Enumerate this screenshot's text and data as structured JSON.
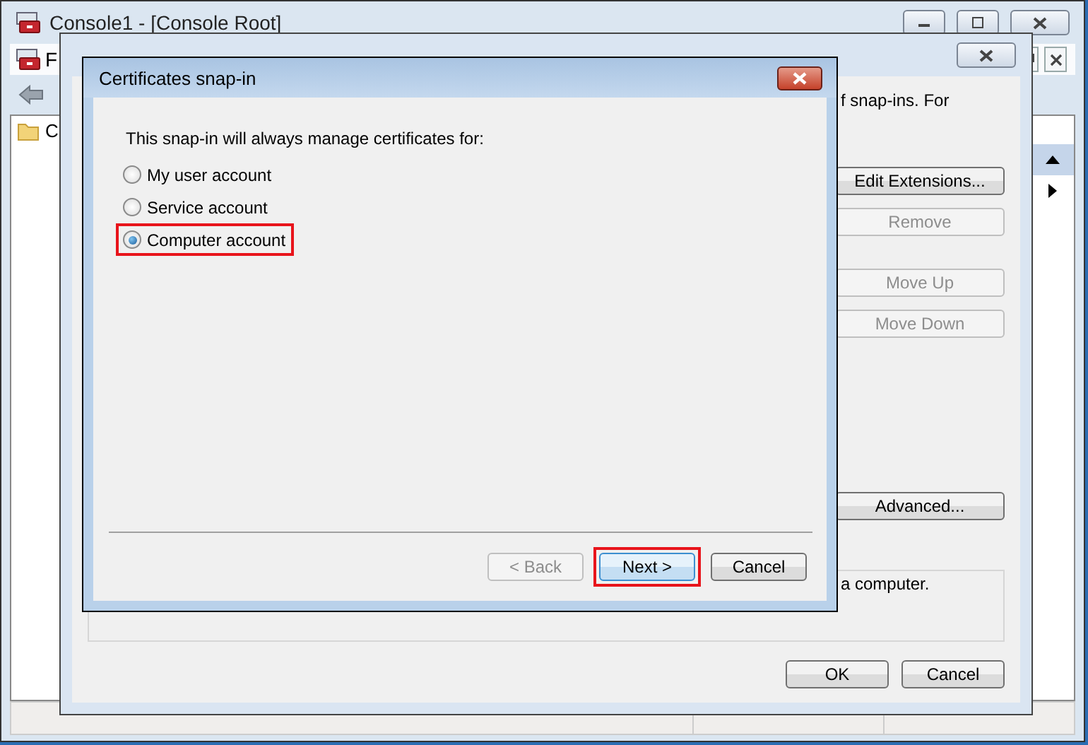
{
  "console_window": {
    "title": "Console1 - [Console Root]",
    "menu_partial": "F",
    "tree_partial": "C"
  },
  "add_remove_dialog": {
    "intro_partial": "f snap-ins. For",
    "side_buttons": [
      {
        "label": "Edit Extensions...",
        "disabled": false
      },
      {
        "label": "Remove",
        "disabled": true
      },
      {
        "label": "Move Up",
        "disabled": true
      },
      {
        "label": "Move Down",
        "disabled": true
      }
    ],
    "advanced_button": {
      "label": "Advanced...",
      "disabled": false
    },
    "description_partial": "a computer.",
    "footer_buttons": [
      {
        "label": "OK",
        "disabled": false
      },
      {
        "label": "Cancel",
        "disabled": false
      }
    ]
  },
  "cert_dialog": {
    "title": "Certificates snap-in",
    "prompt": "This snap-in will always manage certificates for:",
    "options": [
      {
        "label": "My user account",
        "selected": false,
        "highlighted": false
      },
      {
        "label": "Service account",
        "selected": false,
        "highlighted": false
      },
      {
        "label": "Computer account",
        "selected": true,
        "highlighted": true
      }
    ],
    "buttons": [
      {
        "label": "< Back",
        "disabled": true,
        "default": false,
        "highlighted": false
      },
      {
        "label": "Next >",
        "disabled": false,
        "default": true,
        "highlighted": true
      },
      {
        "label": "Cancel",
        "disabled": false,
        "default": false,
        "highlighted": false
      }
    ]
  }
}
